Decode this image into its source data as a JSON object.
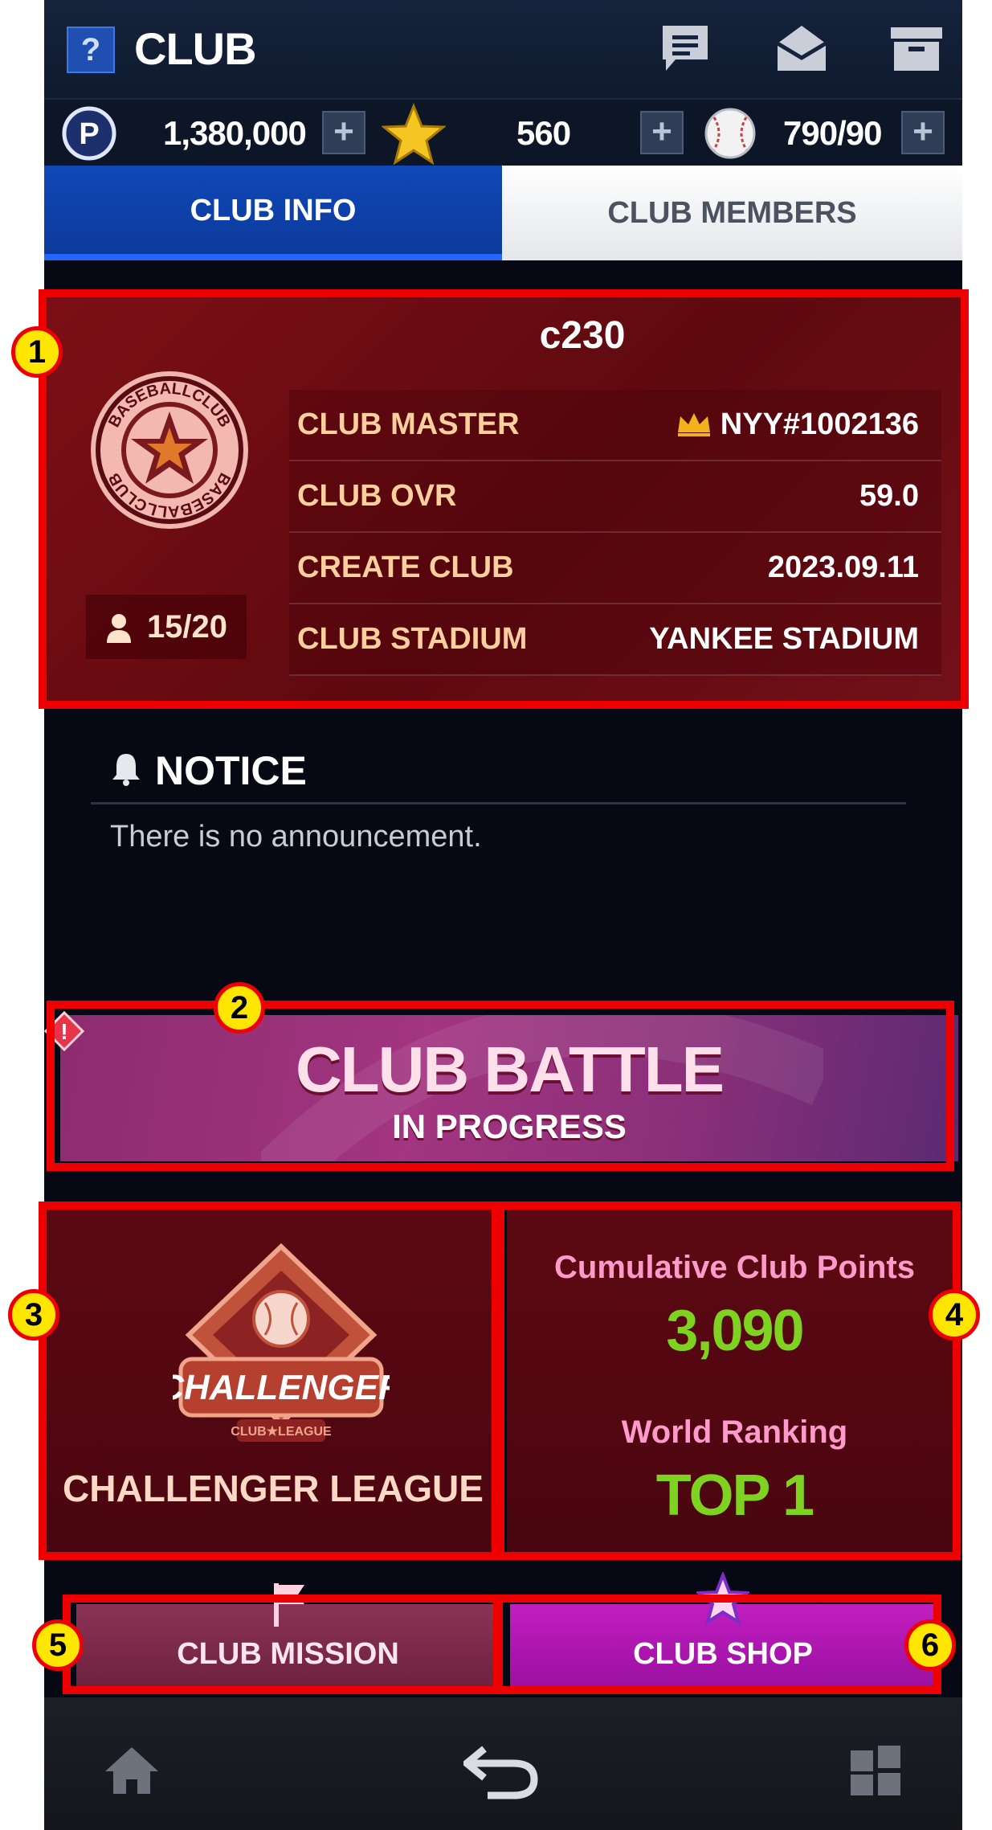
{
  "header": {
    "help_label": "?",
    "title": "CLUB"
  },
  "header_icons": [
    "chat-icon",
    "mail-icon",
    "inbox-icon"
  ],
  "currency": {
    "points": "1,380,000",
    "stars": "560",
    "balls": "790/90",
    "plus": "+"
  },
  "tabs": {
    "info": "CLUB INFO",
    "members": "CLUB MEMBERS"
  },
  "club": {
    "name": "c230",
    "emblem_text_top": "BASEBALLCLUB",
    "emblem_text_bottom": "BASEBALLCLUB",
    "member_count": "15/20",
    "rows": [
      {
        "label": "CLUB MASTER",
        "value": "NYY#1002136"
      },
      {
        "label": "CLUB OVR",
        "value": "59.0"
      },
      {
        "label": "CREATE CLUB",
        "value": "2023.09.11"
      },
      {
        "label": "CLUB STADIUM",
        "value": "YANKEE STADIUM"
      }
    ]
  },
  "notice": {
    "title": "NOTICE",
    "text": "There is no announcement."
  },
  "battle": {
    "title": "CLUB BATTLE",
    "subtitle": "IN PROGRESS",
    "alert": "!"
  },
  "league": {
    "badge_text": "CHALLENGER",
    "badge_sub": "CLUB★LEAGUE",
    "name": "CHALLENGER LEAGUE"
  },
  "points": {
    "cumulative_label": "Cumulative Club Points",
    "cumulative_value": "3,090",
    "ranking_label": "World Ranking",
    "ranking_value": "TOP 1"
  },
  "buttons": {
    "mission": "CLUB MISSION",
    "shop": "CLUB SHOP"
  },
  "markers": [
    "1",
    "2",
    "3",
    "4",
    "5",
    "6"
  ],
  "colors": {
    "annotation": "#ee0000",
    "marker_fill": "#ffe600",
    "points_green": "#7ed321",
    "tab_active": "#1048b8"
  }
}
